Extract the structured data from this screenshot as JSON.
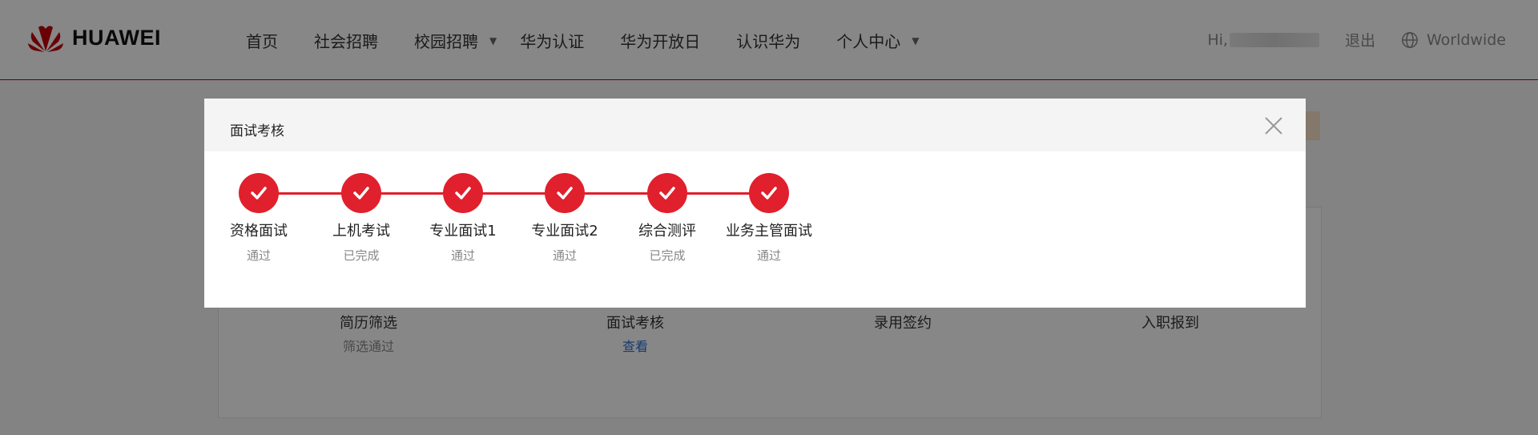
{
  "header": {
    "logo_text": "HUAWEI",
    "nav": [
      {
        "label": "首页",
        "has_caret": false
      },
      {
        "label": "社会招聘",
        "has_caret": false
      },
      {
        "label": "校园招聘",
        "has_caret": true
      },
      {
        "label": "华为认证",
        "has_caret": false
      },
      {
        "label": "华为开放日",
        "has_caret": false
      },
      {
        "label": "认识华为",
        "has_caret": false
      },
      {
        "label": "个人中心",
        "has_caret": true
      }
    ],
    "greeting": "Hi,",
    "logout": "退出",
    "language": "Worldwide",
    "caret_glyph": "▼"
  },
  "background_card": {
    "steps": [
      {
        "label": "简历筛选",
        "sub": "筛选通过",
        "state": "done"
      },
      {
        "label": "面试考核",
        "sub": "查看",
        "state": "done"
      },
      {
        "label": "录用签约",
        "sub": "",
        "state": "todo"
      },
      {
        "label": "入职报到",
        "sub": "",
        "state": "todo"
      }
    ]
  },
  "modal": {
    "title": "面试考核",
    "close_icon": "close-icon",
    "steps": [
      {
        "label": "资格面试",
        "status": "通过"
      },
      {
        "label": "上机考试",
        "status": "已完成"
      },
      {
        "label": "专业面试1",
        "status": "通过"
      },
      {
        "label": "专业面试2",
        "status": "通过"
      },
      {
        "label": "综合测评",
        "status": "已完成"
      },
      {
        "label": "业务主管面试",
        "status": "通过"
      }
    ]
  },
  "colors": {
    "brand_red": "#e0202c",
    "overlay": "rgba(0,0,0,0.47)"
  }
}
